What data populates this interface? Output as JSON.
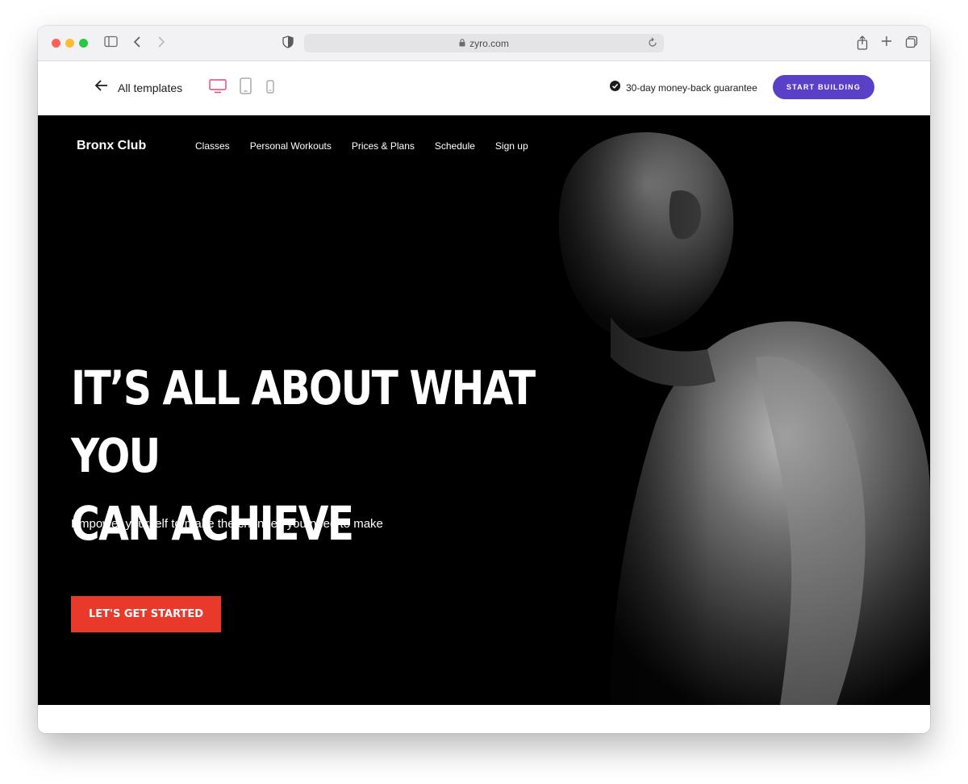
{
  "browser": {
    "url": "zyro.com",
    "icons": [
      "sidebar-icon",
      "back-icon",
      "forward-icon",
      "shield-icon",
      "lock-icon",
      "reload-icon",
      "share-icon",
      "new-tab-icon",
      "tabs-icon"
    ]
  },
  "toolbar": {
    "back_label": "All templates",
    "devices": [
      "desktop-icon",
      "tablet-icon",
      "mobile-icon"
    ],
    "guarantee": "30-day money-back guarantee",
    "start_label": "START BUILDING",
    "accent_color": "#5a3fc7",
    "active_device_color": "#e0457b"
  },
  "site": {
    "brand": "Bronx Club",
    "nav": [
      "Classes",
      "Personal Workouts",
      "Prices & Plans",
      "Schedule",
      "Sign up"
    ],
    "headline_line1": "IT’S ALL ABOUT WHAT YOU",
    "headline_line2": "CAN ACHIEVE",
    "subhead": "Empower yourself to make the changes you need to make",
    "cta_label": "LET'S GET STARTED",
    "cta_color": "#e8392b"
  }
}
